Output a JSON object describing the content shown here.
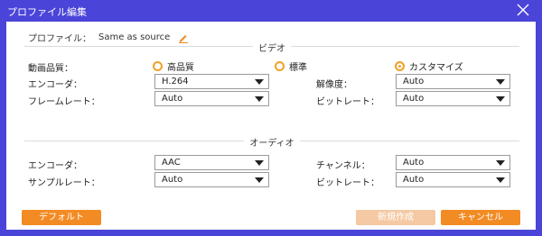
{
  "window": {
    "title": "プロファイル編集",
    "close_icon": "close-icon"
  },
  "profile": {
    "label": "プロファイル：",
    "value": "Same as source",
    "edit_icon": "pencil-icon"
  },
  "video": {
    "section_title": "ビデオ",
    "quality": {
      "label": "動画品質：",
      "options": [
        {
          "label": "高品質",
          "selected": false
        },
        {
          "label": "標準",
          "selected": false
        },
        {
          "label": "カスタマイズ",
          "selected": true
        }
      ]
    },
    "encoder": {
      "label": "エンコーダ：",
      "value": "H.264"
    },
    "resolution": {
      "label": "解像度：",
      "value": "Auto"
    },
    "frame_rate": {
      "label": "フレームレート：",
      "value": "Auto"
    },
    "bitrate": {
      "label": "ビットレート：",
      "value": "Auto"
    }
  },
  "audio": {
    "section_title": "オーディオ",
    "encoder": {
      "label": "エンコーダ：",
      "value": "AAC"
    },
    "channel": {
      "label": "チャンネル：",
      "value": "Auto"
    },
    "sample_rate": {
      "label": "サンプルレート：",
      "value": "Auto"
    },
    "bitrate": {
      "label": "ビットレート：",
      "value": "Auto"
    }
  },
  "buttons": {
    "default": "デフォルト",
    "new": "新規作成",
    "cancel": "キャンセル"
  },
  "colors": {
    "frame": "#4a44d8",
    "accent": "#f28b24",
    "disabled": "#f4c9a3"
  }
}
